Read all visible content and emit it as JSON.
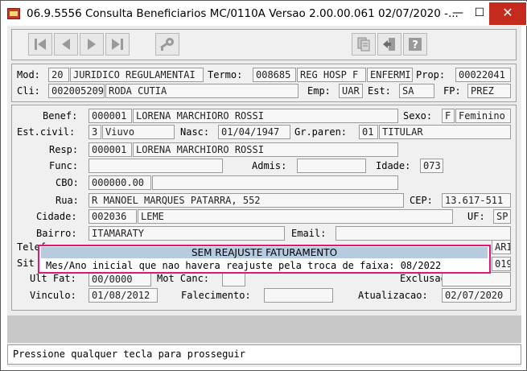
{
  "window": {
    "title": "06.9.5556 Consulta  Beneficiarios MC/0110A Versao 2.00.00.061 02/07/2020 -...",
    "minimize": "—",
    "maximize": "☐",
    "close": "✕"
  },
  "toolbar": {
    "icons": [
      "first-record-icon",
      "previous-record-icon",
      "next-record-icon",
      "last-record-icon",
      "key-icon",
      "copy-icon",
      "exit-icon",
      "help-icon"
    ],
    "help_glyph": "?"
  },
  "header": {
    "mod_label": "Mod:",
    "mod_code": "20",
    "mod_desc": "JURIDICO REGULAMENTAI",
    "termo_label": "Termo:",
    "termo_code": "008685",
    "termo_desc1": "REG HOSP F",
    "termo_desc2": "ENFERMI",
    "prop_label": "Prop:",
    "prop_value": "00022041",
    "cli_label": "Cli:",
    "cli_code": "002005209",
    "cli_name": "RODA CUTIA",
    "emp_label": "Emp:",
    "emp_value": "UAR",
    "est_label": "Est:",
    "est_value": "SA",
    "fp_label": "FP:",
    "fp_value": "PREZ"
  },
  "form": {
    "benef_label": "Benef:",
    "benef_code": "000001",
    "benef_name": "LORENA MARCHIORO ROSSI",
    "sexo_label": "Sexo:",
    "sexo_code": "F",
    "sexo_desc": "Feminino",
    "estcivil_label": "Est.civil:",
    "estcivil_code": "3",
    "estcivil_desc": "Viuvo",
    "nasc_label": "Nasc:",
    "nasc_value": "01/04/1947",
    "grparen_label": "Gr.paren:",
    "grparen_code": "01",
    "grparen_desc": "TITULAR",
    "resp_label": "Resp:",
    "resp_code": "000001",
    "resp_name": "LORENA MARCHIORO ROSSI",
    "func_label": "Func:",
    "admis_label": "Admis:",
    "idade_label": "Idade:",
    "idade_value": "073",
    "cbo_label": "CBO:",
    "cbo_value": "000000.00",
    "rua_label": "Rua:",
    "rua_value": "R MANOEL MARQUES PATARRA, 552",
    "cep_label": "CEP:",
    "cep_value": "13.617-511",
    "cidade_label": "Cidade:",
    "cidade_code": "002036",
    "cidade_name": "LEME",
    "uf_label": "UF:",
    "uf_value": "SP",
    "bairro_label": "Bairro:",
    "bairro_value": "ITAMARATY",
    "email_label": "Email:",
    "telef_label": "Telef",
    "sit_label": "Sit",
    "right_partial1": "ARI",
    "right_partial2": "019",
    "ultfat_label": "Ult Fat:",
    "ultfat_value": "00/0000",
    "motcanc_label": "Mot Canc:",
    "exclusao_label": "Exclusao:",
    "vinculo_label": "Vinculo:",
    "vinculo_value": "01/08/2012",
    "falecimento_label": "Falecimento:",
    "atualizacao_label": "Atualizacao:",
    "atualizacao_value": "02/07/2020"
  },
  "dialog": {
    "title": "SEM REAJUSTE FATURAMENTO",
    "message": "Mes/Ano inicial que nao havera reajuste pela troca de faixa: 08/2022"
  },
  "status": {
    "message": "Pressione qualquer tecla para prosseguir"
  },
  "colors": {
    "dialog_border": "#e0177a",
    "dialog_title_bg": "#b7cbe0",
    "close_button": "#c42b1c"
  }
}
